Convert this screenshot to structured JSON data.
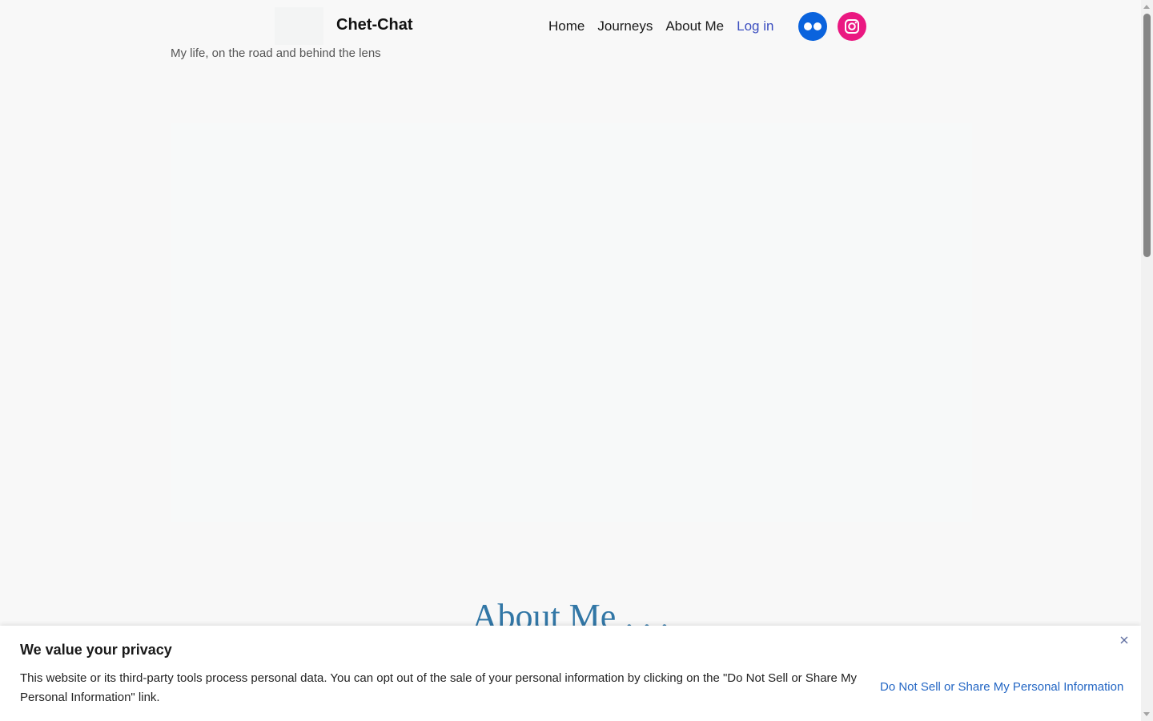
{
  "header": {
    "site_title": "Chet-Chat",
    "tagline": "My life, on the road and behind the lens",
    "nav": {
      "home": "Home",
      "journeys": "Journeys",
      "about": "About Me",
      "login": "Log in"
    },
    "social": {
      "flickr_icon": "flickr-icon",
      "instagram_icon": "instagram-icon",
      "flickr_color": "#0a63dd",
      "instagram_color": "#ea1881"
    }
  },
  "main": {
    "about_heading": "About Me . . ."
  },
  "privacy_banner": {
    "title": "We value your privacy",
    "text": "This website or its third-party tools process personal data. You can opt out of the sale of your personal information by clicking on the \"Do Not Sell or Share My Personal Information\" link.",
    "link": "Do Not Sell or Share My Personal Information",
    "close_icon": "close-icon"
  },
  "colors": {
    "accent_link": "#3a4dbf",
    "heading": "#3277a6",
    "privacy_link": "#2366c4"
  }
}
